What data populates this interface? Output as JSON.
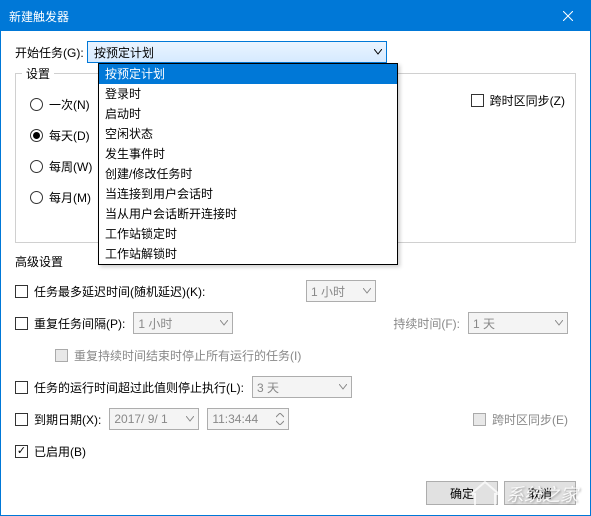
{
  "title": "新建触发器",
  "begin_label": "开始任务(G):",
  "begin_selected": "按预定计划",
  "dropdown": [
    "按预定计划",
    "登录时",
    "启动时",
    "空闲状态",
    "发生事件时",
    "创建/修改任务时",
    "当连接到用户会话时",
    "当从用户会话断开连接时",
    "工作站锁定时",
    "工作站解锁时"
  ],
  "settings_label": "设置",
  "schedule": {
    "once": "一次(N)",
    "daily": "每天(D)",
    "weekly": "每周(W)",
    "monthly": "每月(M)"
  },
  "sync_across_tz_top": "跨时区同步(Z)",
  "advanced_label": "高级设置",
  "adv": {
    "random_delay": "任务最多延迟时间(随机延迟)(K):",
    "random_delay_val": "1 小时",
    "repeat": "重复任务间隔(P):",
    "repeat_val": "1 小时",
    "duration_label": "持续时间(F):",
    "duration_val": "1 天",
    "stop_all_after": "重复持续时间结束时停止所有运行的任务(I)",
    "stop_if_longer": "任务的运行时间超过此值则停止执行(L):",
    "stop_if_longer_val": "3 天",
    "expire": "到期日期(X):",
    "expire_date": "2017/ 9/ 1",
    "expire_time": "11:34:44",
    "sync_across_tz_bottom": "跨时区同步(E)",
    "enabled": "已启用(B)"
  },
  "buttons": {
    "ok": "确定",
    "cancel": "取消"
  },
  "watermark": "系统之家"
}
